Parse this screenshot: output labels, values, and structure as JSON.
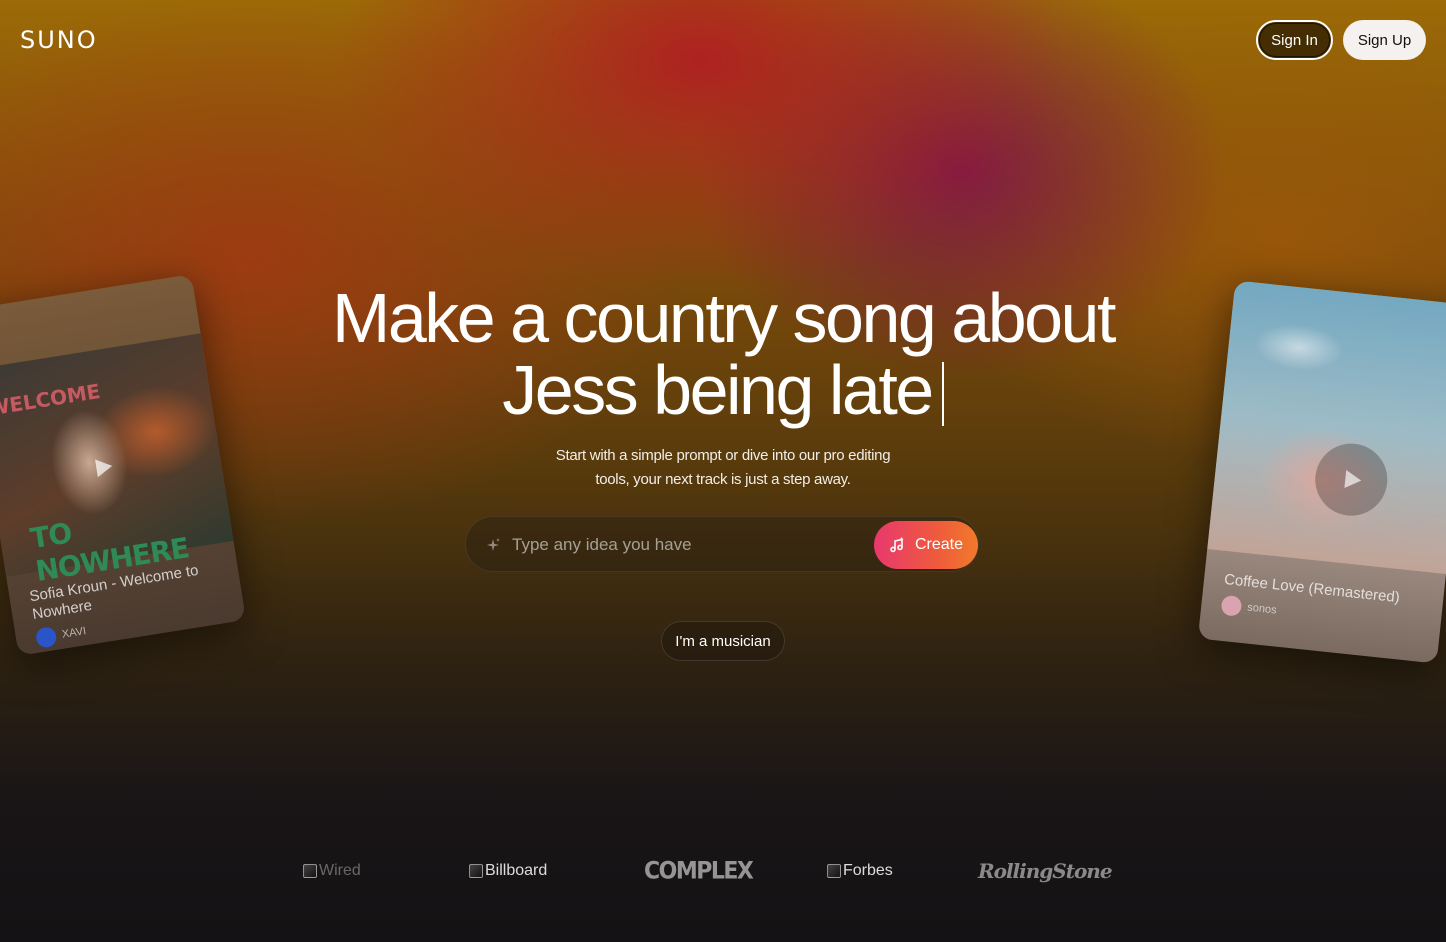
{
  "brand": {
    "logo": "SUNO"
  },
  "header": {
    "sign_in": "Sign In",
    "sign_up": "Sign Up"
  },
  "hero": {
    "headline_line1": "Make a country song about",
    "headline_line2": "Jess being late",
    "subtitle_line1": "Start with a simple prompt or dive into our pro editing",
    "subtitle_line2": "tools, your next track is just a step away."
  },
  "prompt": {
    "placeholder": "Type any idea you have",
    "create_label": "Create",
    "accent_gradient": [
      "#e8386e",
      "#f07a2a"
    ]
  },
  "musician_button": "I'm a musician",
  "cards": {
    "left": {
      "title": "Sofia Kroun - Welcome to Nowhere",
      "author": "XAVI",
      "art_text": "TO NOWHERE",
      "art_vertical": "WELCOME",
      "art_artist": "Sofia Kroun"
    },
    "right": {
      "title": "Coffee Love (Remastered)",
      "author": "sonos"
    }
  },
  "press": {
    "wired": "Wired",
    "billboard": "Billboard",
    "complex": "COMPLEX",
    "forbes": "Forbes",
    "rolling_stone": "RollingStone"
  }
}
